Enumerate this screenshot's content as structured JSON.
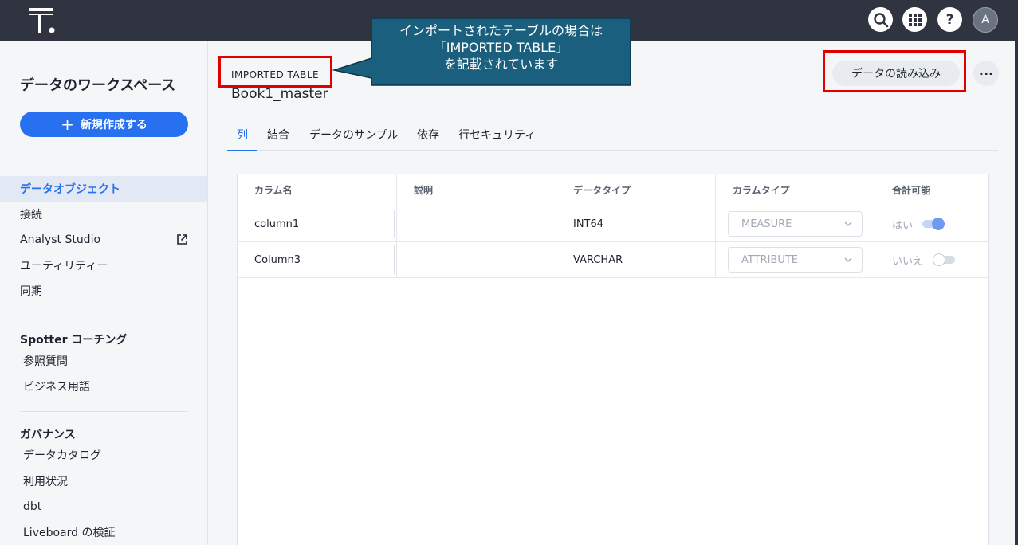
{
  "topbar": {
    "icons": [
      "search-icon",
      "apps-grid-icon",
      "help-icon"
    ],
    "help_glyph": "?",
    "avatar_initial": "A"
  },
  "sidebar": {
    "title": "データのワークスペース",
    "new_button": "新規作成する",
    "items": [
      {
        "label": "データオブジェクト",
        "active": true
      },
      {
        "label": "接続"
      },
      {
        "label": "Analyst Studio",
        "icon": "external-link-icon"
      },
      {
        "label": "ユーティリティー"
      },
      {
        "label": "同期"
      }
    ],
    "spotter": {
      "heading": "Spotter コーチング",
      "items": [
        "参照質問",
        "ビジネス用語"
      ]
    },
    "governance": {
      "heading": "ガバナンス",
      "items": [
        "データカタログ",
        "利用状況",
        "dbt",
        "Liveboard の検証"
      ]
    }
  },
  "main": {
    "type_label": "IMPORTED TABLE",
    "table_name": "Book1_master",
    "load_button": "データの読み込み",
    "more_glyph": "···",
    "callout": {
      "line1": "インポートされたテーブルの場合は",
      "line2": "「IMPORTED TABLE」",
      "line3": "を記載されています"
    },
    "tabs": [
      "列",
      "結合",
      "データのサンプル",
      "依存",
      "行セキュリティ"
    ],
    "active_tab": 0,
    "columns_table": {
      "headers": [
        "カラム名",
        "説明",
        "データタイプ",
        "カラムタイプ",
        "合計可能"
      ],
      "rows": [
        {
          "name": "column1",
          "description": "",
          "data_type": "INT64",
          "column_type": "MEASURE",
          "aggregatable": "はい",
          "toggle_on": true
        },
        {
          "name": "Column3",
          "description": "",
          "data_type": "VARCHAR",
          "column_type": "ATTRIBUTE",
          "aggregatable": "いいえ",
          "toggle_on": false
        }
      ]
    }
  },
  "colors": {
    "topbar": "#2f3440",
    "accent": "#2770ef",
    "annotation_red": "#e00000",
    "callout_fill": "#1a5f7e"
  }
}
